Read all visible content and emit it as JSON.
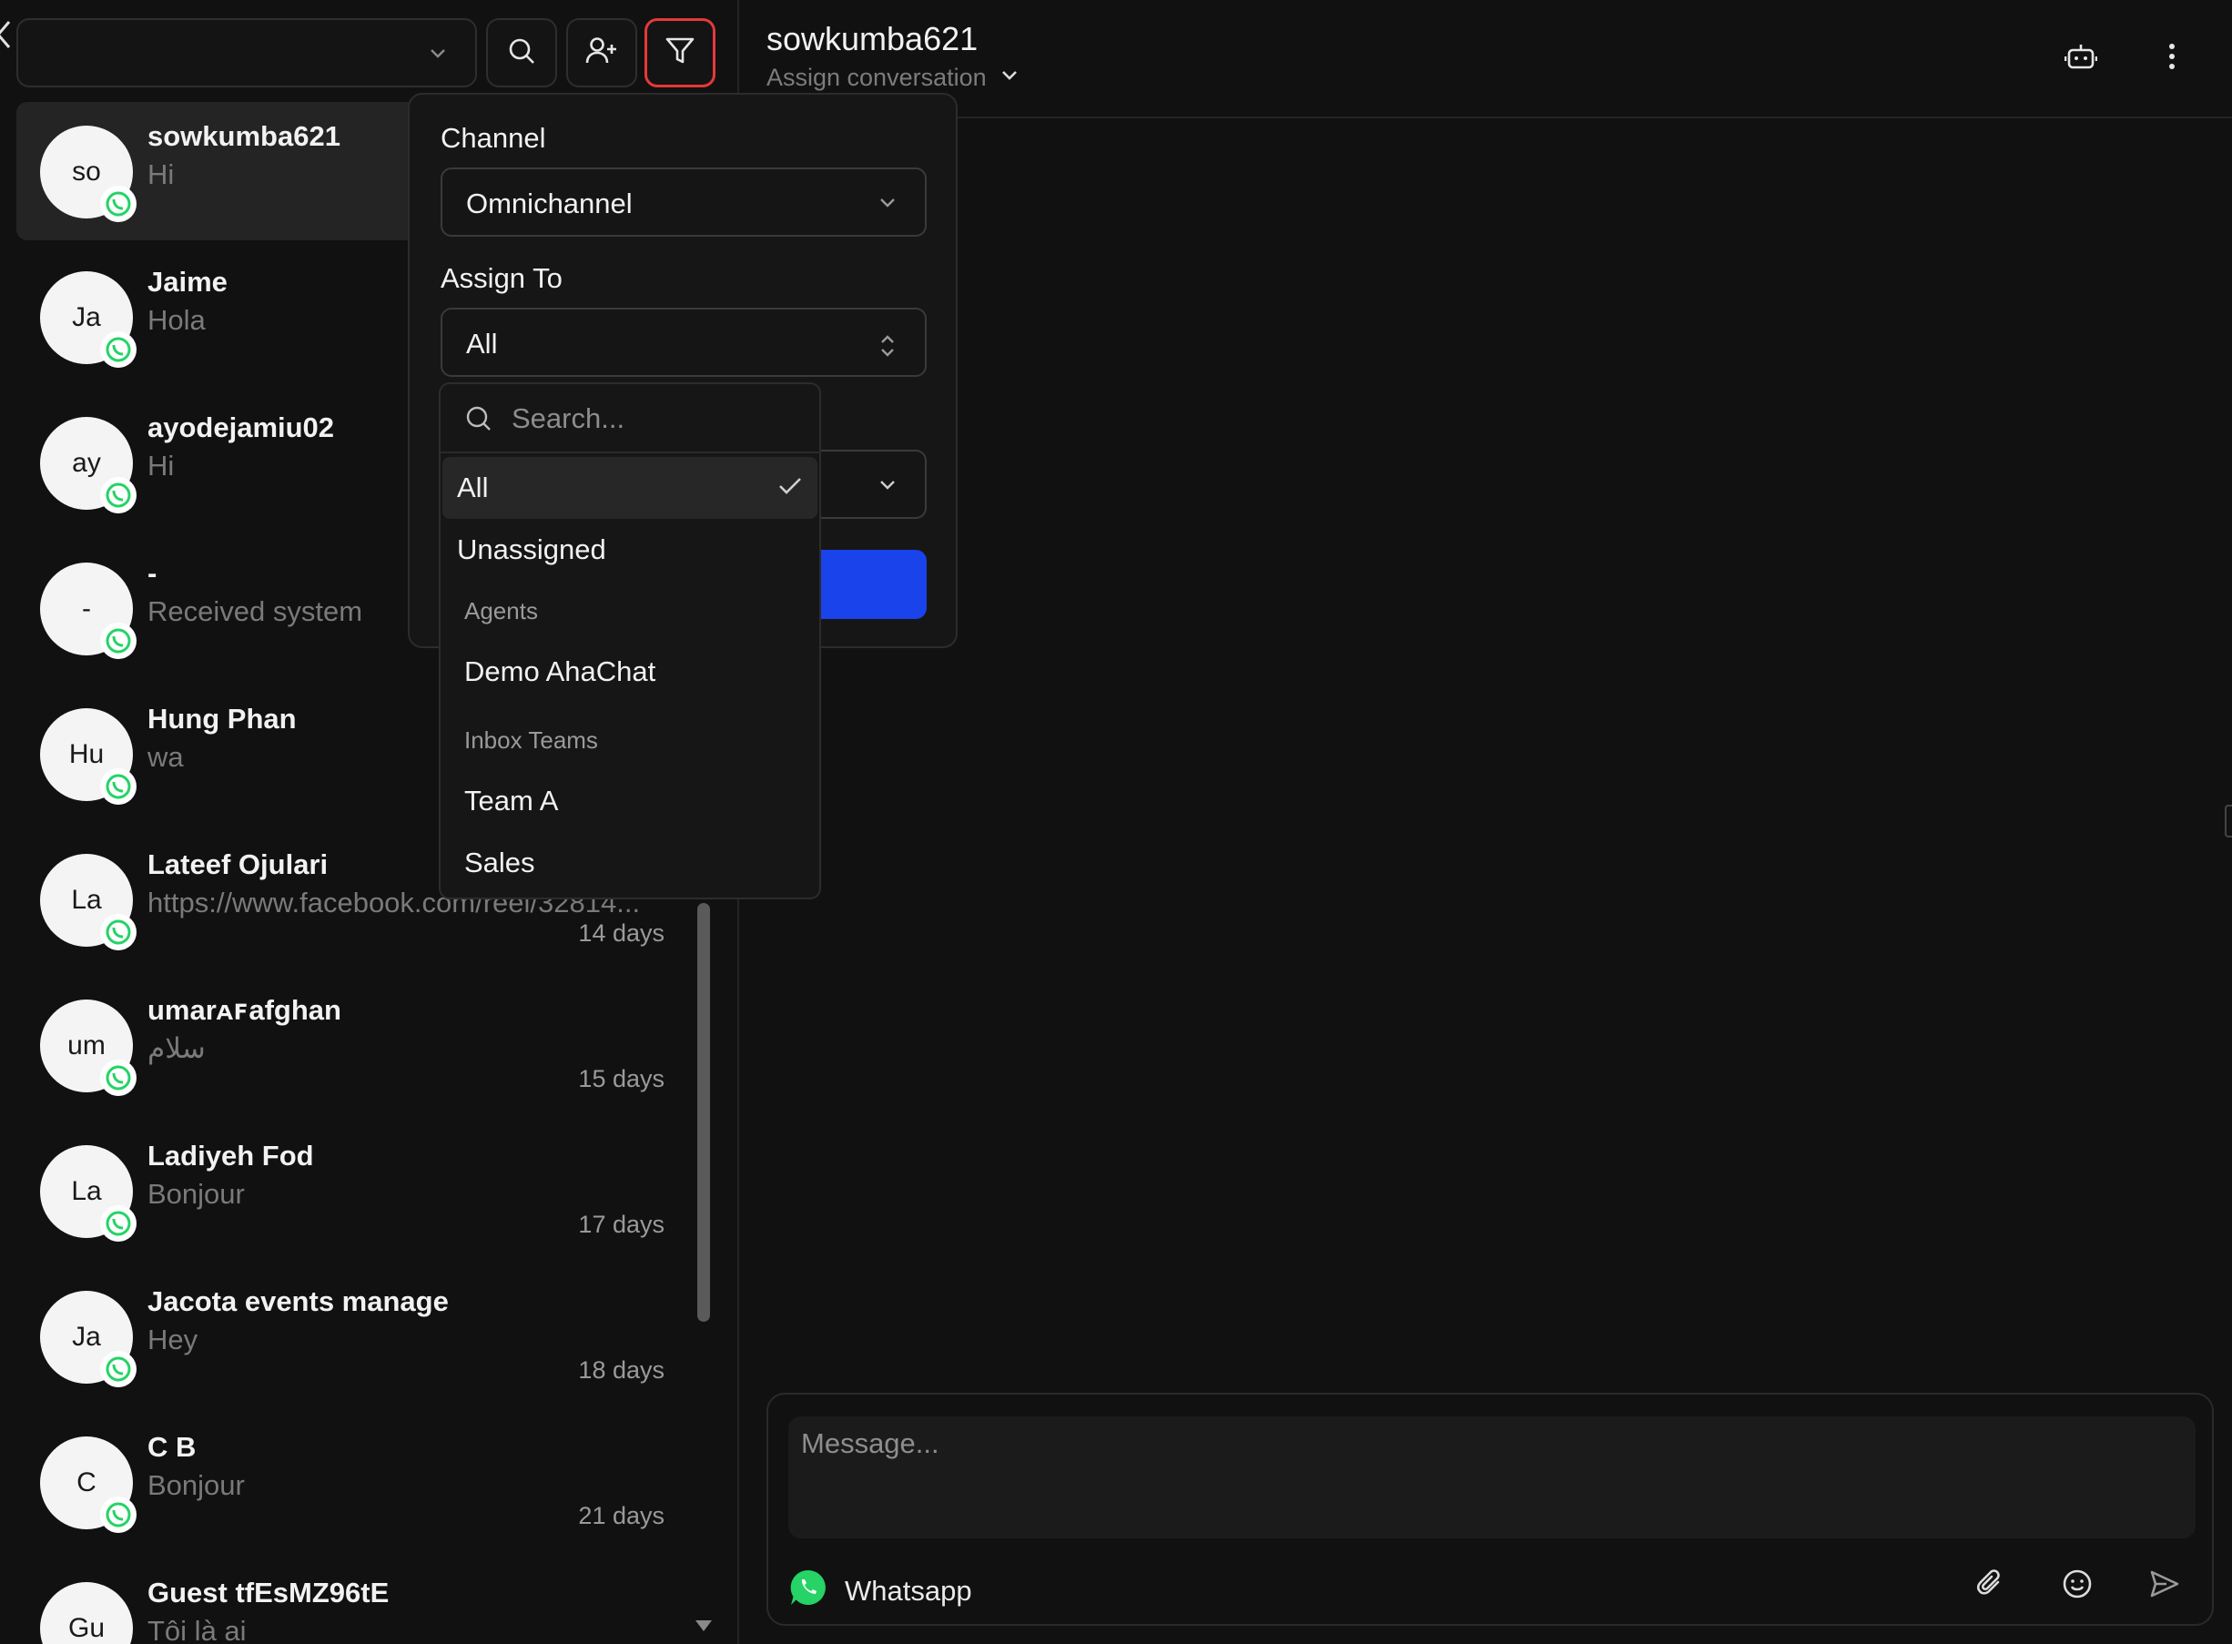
{
  "sidebar": {
    "inbox_select_value": "",
    "conversations": [
      {
        "initials": "so",
        "name": "sowkumba621",
        "preview": "Hi",
        "time": ""
      },
      {
        "initials": "Ja",
        "name": "Jaime",
        "preview": "Hola",
        "time": ""
      },
      {
        "initials": "ay",
        "name": "ayodejamiu02",
        "preview": "Hi",
        "time": ""
      },
      {
        "initials": "-",
        "name": "-",
        "preview": "Received system",
        "time": ""
      },
      {
        "initials": "Hu",
        "name": "Hung Phan",
        "preview": "wa",
        "time": ""
      },
      {
        "initials": "La",
        "name": "Lateef Ojulari",
        "preview": "https://www.facebook.com/reel/32814...",
        "time": "14 days"
      },
      {
        "initials": "um",
        "name": "umarᴀꜰafghan",
        "preview": "سلام",
        "time": "15 days"
      },
      {
        "initials": "La",
        "name": "Ladiyeh Fod",
        "preview": "Bonjour",
        "time": "17 days"
      },
      {
        "initials": "Ja",
        "name": "Jacota events manage",
        "preview": "Hey",
        "time": "18 days"
      },
      {
        "initials": "C",
        "name": "C B",
        "preview": "Bonjour",
        "time": "21 days"
      },
      {
        "initials": "Gu",
        "name": "Guest tfEsMZ96tE",
        "preview": "Tôi là ai",
        "time": ""
      }
    ]
  },
  "header": {
    "contact_name": "sowkumba621",
    "assign_label": "Assign conversation"
  },
  "filter": {
    "channel_label": "Channel",
    "channel_value": "Omnichannel",
    "assign_label": "Assign To",
    "assign_value": "All"
  },
  "assign_dropdown": {
    "search_placeholder": "Search...",
    "options": {
      "all": "All",
      "unassigned": "Unassigned"
    },
    "agents_group": "Agents",
    "agents": [
      "Demo AhaChat"
    ],
    "teams_group": "Inbox Teams",
    "teams": [
      "Team A",
      "Sales"
    ]
  },
  "composer": {
    "placeholder": "Message...",
    "channel": "Whatsapp"
  },
  "colors": {
    "accent": "#1a43ec",
    "whatsapp": "#25d366",
    "highlight": "#e5393a"
  }
}
